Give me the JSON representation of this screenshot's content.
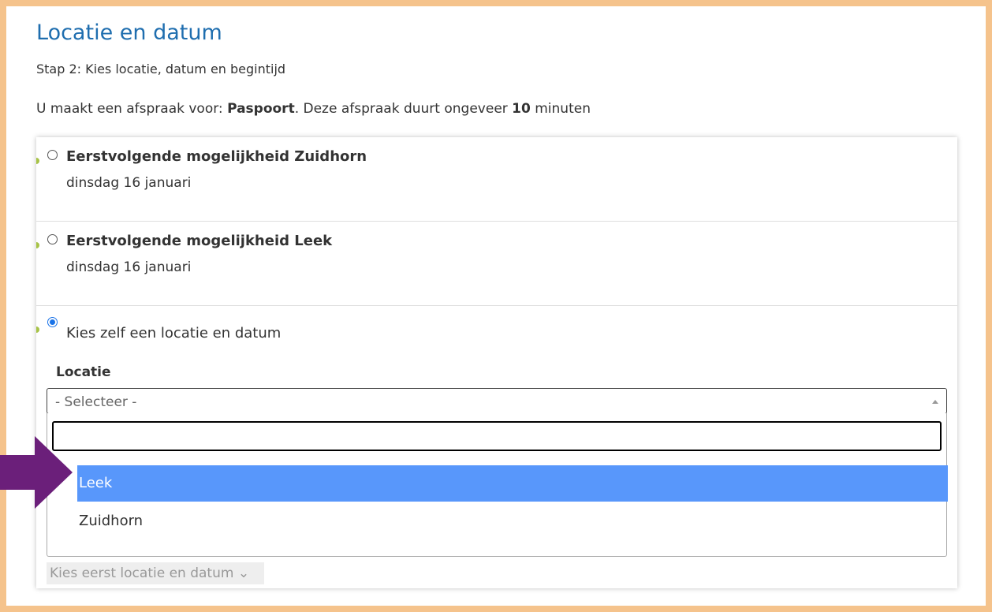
{
  "header": {
    "title": "Locatie en datum",
    "step": "Stap 2: Kies locatie, datum en begintijd"
  },
  "info": {
    "prefix": "U maakt een afspraak voor: ",
    "product": "Paspoort",
    "middle": ". Deze afspraak duurt ongeveer ",
    "duration": "10",
    "suffix": " minuten"
  },
  "options": [
    {
      "title": "Eerstvolgende mogelijkheid Zuidhorn",
      "date": "dinsdag 16 januari",
      "checked": false
    },
    {
      "title": "Eerstvolgende mogelijkheid Leek",
      "date": "dinsdag 16 januari",
      "checked": false
    },
    {
      "title": "Kies zelf een locatie en datum",
      "checked": true
    }
  ],
  "location": {
    "label": "Locatie",
    "placeholder": "- Selecteer -",
    "search_value": "",
    "items": [
      "Leek",
      "Zuidhorn"
    ],
    "highlighted": "Leek"
  },
  "time_select": {
    "value": "Kies eerst locatie en datum ⌄"
  },
  "colors": {
    "border": "#f5c38c",
    "title": "#1f6eaf",
    "highlight": "#5897fb",
    "arrow": "#6b1f7a",
    "radio_checked": "#1a73e8"
  },
  "icons": {
    "arrow": "right-arrow-icon"
  }
}
